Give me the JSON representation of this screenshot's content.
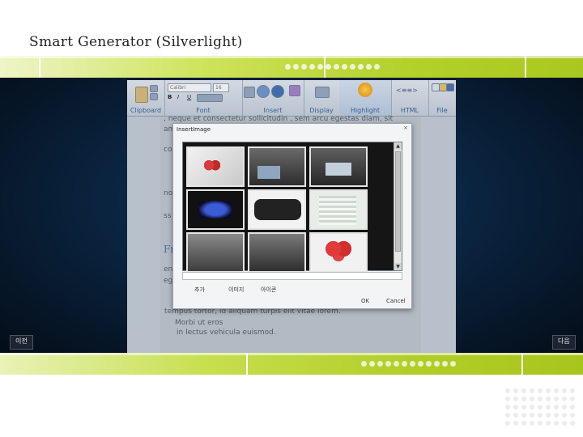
{
  "slide": {
    "title": "Smart Generator (Silverlight)"
  },
  "nav": {
    "prev_label": "이전",
    "next_label": "다음"
  },
  "app": {
    "ribbon": {
      "font_name": "Calibri",
      "font_size": "16",
      "groups": [
        "Clipboard",
        "Font",
        "Insert",
        "Display",
        "Highlight",
        "HTML",
        "File"
      ],
      "html_icon_text": "<≡≡>"
    },
    "document": {
      "lines": [
        ", neque et consectetur sollicitudin , sem arcu egestas diam, sit",
        "am",
        "co",
        "no",
        "ss",
        "Fr",
        "en",
        "eg",
        "tempus tortor, id aliquam turpis elit vitae lorem.",
        "Morbi ut eros",
        "in lectus vehicula euismod."
      ]
    }
  },
  "dialog": {
    "title": "InsertImage",
    "buttons": {
      "add": "추가",
      "prev": "이미지",
      "next": "아이콘",
      "ok": "OK",
      "cancel": "Cancel"
    },
    "scroll": {
      "up": "▲",
      "down": "▼"
    }
  },
  "colors": {
    "accent_green": "#b3d02b",
    "stage": "#0a2440",
    "heading_blue": "#4d6aa8"
  }
}
